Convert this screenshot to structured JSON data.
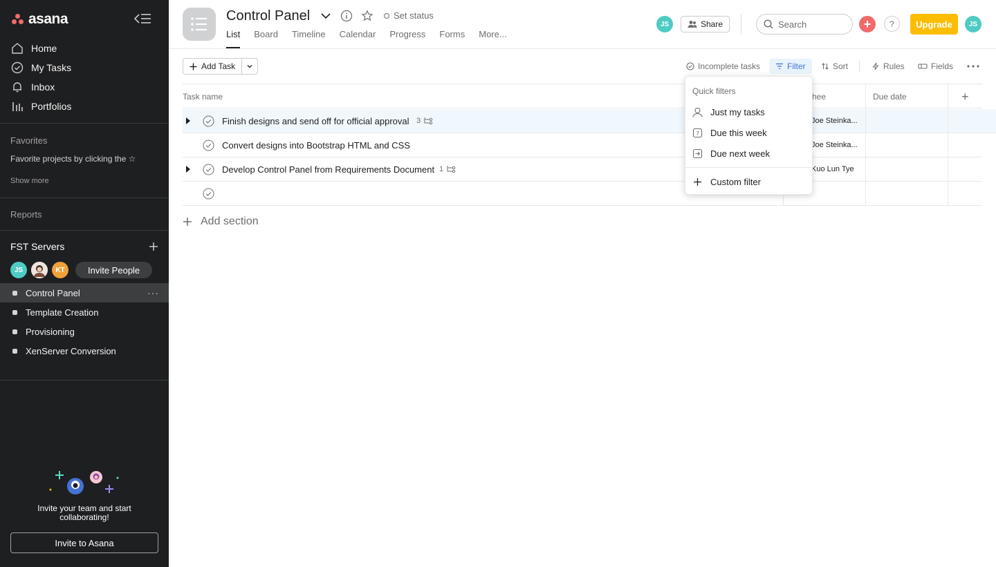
{
  "app": {
    "name": "asana"
  },
  "sidebar": {
    "nav": [
      {
        "label": "Home",
        "icon": "home-icon"
      },
      {
        "label": "My Tasks",
        "icon": "check-circle-icon"
      },
      {
        "label": "Inbox",
        "icon": "bell-icon"
      },
      {
        "label": "Portfolios",
        "icon": "bar-chart-icon"
      }
    ],
    "favorites_label": "Favorites",
    "favorites_hint": "Favorite projects by clicking the ☆",
    "show_more": "Show more",
    "reports": "Reports",
    "team": {
      "name": "FST Servers",
      "members": [
        {
          "initials": "JS",
          "color": "#4ecbc4"
        },
        {
          "initials": "",
          "color": "#e8d0c8"
        },
        {
          "initials": "KT",
          "color": "#f1a13a"
        }
      ],
      "invite_label": "Invite People"
    },
    "projects": [
      {
        "label": "Control Panel",
        "active": true
      },
      {
        "label": "Template Creation"
      },
      {
        "label": "Provisioning"
      },
      {
        "label": "XenServer Conversion"
      }
    ],
    "invite_text": "Invite your team and start collaborating!",
    "invite_button": "Invite to Asana"
  },
  "header": {
    "title": "Control Panel",
    "set_status": "Set status",
    "tabs": [
      "List",
      "Board",
      "Timeline",
      "Calendar",
      "Progress",
      "Forms",
      "More..."
    ],
    "active_tab": "List",
    "member_initials": "JS",
    "share": "Share",
    "search_placeholder": "Search",
    "help": "?",
    "upgrade": "Upgrade",
    "user_initials": "JS"
  },
  "toolbar": {
    "add_task": "Add Task",
    "incomplete": "Incomplete tasks",
    "filter": "Filter",
    "sort": "Sort",
    "rules": "Rules",
    "fields": "Fields"
  },
  "table": {
    "columns": {
      "task_name": "Task name",
      "assignee": "hee",
      "due_date": "Due date"
    },
    "rows": [
      {
        "name": "Finish designs and send off for official approval",
        "subtasks": "3",
        "assignee": "Joe Steinka...",
        "expandable": true
      },
      {
        "name": "Convert designs into Bootstrap HTML and CSS",
        "subtasks": "",
        "assignee": "Joe Steinka...",
        "expandable": false
      },
      {
        "name": "Develop Control Panel from Requirements Document",
        "subtasks": "1",
        "assignee": "Kuo Lun Tye",
        "expandable": true
      },
      {
        "name": "",
        "subtasks": "",
        "assignee": "",
        "expandable": false
      }
    ],
    "add_section": "Add section"
  },
  "filter_menu": {
    "label": "Quick filters",
    "items": [
      {
        "label": "Just my tasks",
        "icon": "person-icon"
      },
      {
        "label": "Due this week",
        "icon": "calendar-7-icon"
      },
      {
        "label": "Due next week",
        "icon": "calendar-next-icon"
      }
    ],
    "custom": "Custom filter"
  },
  "colors": {
    "sidebar_bg": "#1e1f21",
    "accent": "#4573d2",
    "upgrade": "#fcbd01",
    "add": "#f06a6a"
  }
}
